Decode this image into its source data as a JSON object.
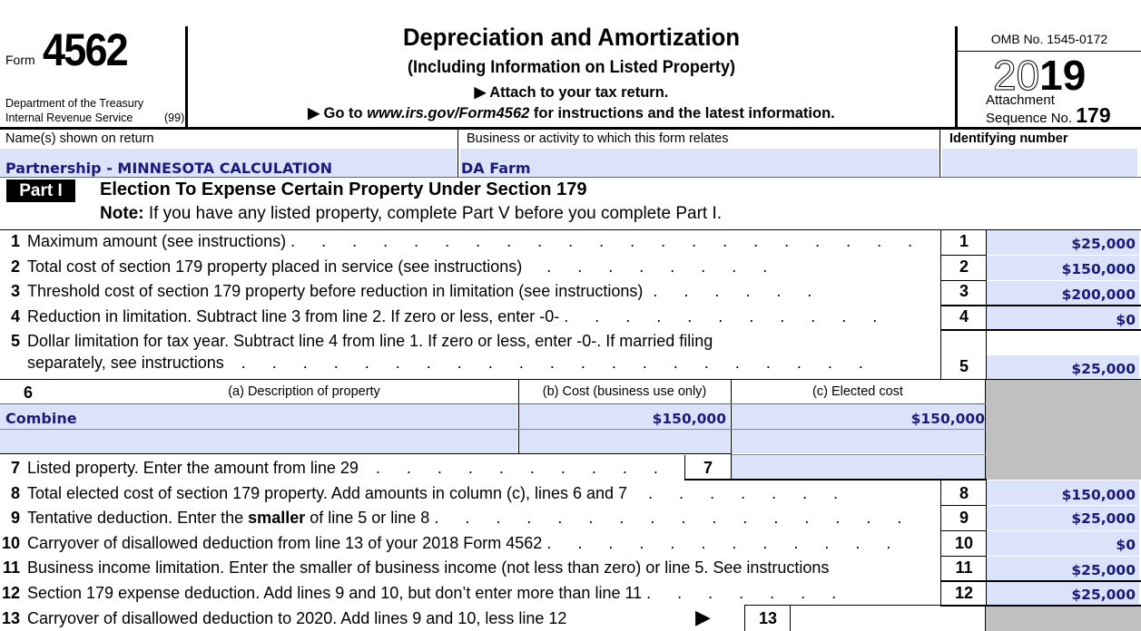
{
  "header": {
    "form_word": "Form",
    "form_number": "4562",
    "department": "Department of the Treasury",
    "irs": "Internal Revenue Service",
    "irs_code": "(99)",
    "title": "Depreciation and Amortization",
    "subtitle": "(Including Information on Listed Property)",
    "attach_instruction": "▶ Attach to your tax return.",
    "goto_prefix": "▶ Go to ",
    "goto_url": "www.irs.gov/Form4562",
    "goto_suffix": " for instructions and the latest information.",
    "omb": "OMB No. 1545-0172",
    "year_outline": "20",
    "year_bold": "19",
    "attachment_label": "Attachment",
    "sequence_label": "Sequence No.",
    "sequence_number": "179"
  },
  "identity": {
    "name_label": "Name(s) shown on return",
    "name_value": "Partnership - MINNESOTA CALCULATION",
    "business_label": "Business or activity to which this form relates",
    "business_value": "DA Farm",
    "id_label": "Identifying number",
    "id_value": ""
  },
  "part1": {
    "badge": "Part I",
    "title": "Election To Expense Certain Property Under Section 179",
    "note_bold": "Note:",
    "note_text": " If you have any listed property, complete Part V before you complete Part I.",
    "lines": [
      {
        "num": "1",
        "text": "Maximum amount (see instructions)",
        "dots": ". . . . . . . . . . . . . . . . . . . . .",
        "box": "1",
        "value": "$25,000"
      },
      {
        "num": "2",
        "text": "Total cost of section 179 property placed in service (see instructions)",
        "dots": ". . . . . . . .",
        "box": "2",
        "value": "$150,000"
      },
      {
        "num": "3",
        "text": "Threshold cost of section 179 property before reduction in limitation (see instructions)",
        "dots": ". . . . . .",
        "box": "3",
        "value": "$200,000"
      },
      {
        "num": "4",
        "text": "Reduction in limitation. Subtract line 3 from line 2. If zero or less, enter -0-",
        "dots": ". . . . . . . . . . .",
        "box": "4",
        "value": "$0"
      },
      {
        "num": "5",
        "text": "Dollar limitation for tax year. Subtract line 4 from line 1. If zero or less, enter -0-. If married filing",
        "text2": "separately, see instructions",
        "dots": ". . . . . . . . . . . . . . . . . . . . .",
        "box": "5",
        "value": "$25,000"
      }
    ],
    "line6": {
      "num": "6",
      "col_a": "(a)  Description of property",
      "col_b": "(b)  Cost (business use only)",
      "col_c": "(c)  Elected cost",
      "rows": [
        {
          "description": "Combine",
          "cost": "$150,000",
          "elected": "$150,000"
        },
        {
          "description": "",
          "cost": "",
          "elected": ""
        }
      ]
    },
    "line7": {
      "num": "7",
      "text": "Listed property. Enter the amount from line 29",
      "dots": ". . . . . . . . . .",
      "box": "7",
      "value": ""
    },
    "lines_after": [
      {
        "num": "8",
        "text": "Total elected cost of section 179 property. Add amounts in column (c), lines 6 and 7",
        "dots": ". . . . . . .",
        "box": "8",
        "value": "$150,000"
      },
      {
        "num": "9",
        "text_pre": "Tentative deduction. Enter the ",
        "text_bold": "smaller",
        "text_post": " of line 5 or line 8",
        "dots": ". . . . . . . . . . . . . . . .",
        "box": "9",
        "value": "$25,000"
      },
      {
        "num": "10",
        "text": "Carryover of disallowed deduction from line 13 of your 2018 Form 4562",
        "dots": ". . . . . . . . . . . .",
        "box": "10",
        "value": "$0"
      },
      {
        "num": "11",
        "text": "Business income limitation. Enter the smaller of business income (not less than zero) or line 5. See instructions",
        "dots": "",
        "box": "11",
        "value": "$25,000"
      },
      {
        "num": "12",
        "text": "Section 179 expense deduction. Add lines 9 and 10, but don’t enter more than line 11",
        "dots": ". . . . . . .",
        "box": "12",
        "value": "$25,000"
      }
    ],
    "line13": {
      "num": "13",
      "text": "Carryover of disallowed deduction to 2020. Add lines 9 and 10, less line 12",
      "arrow": "▶",
      "box": "13",
      "value": ""
    }
  }
}
